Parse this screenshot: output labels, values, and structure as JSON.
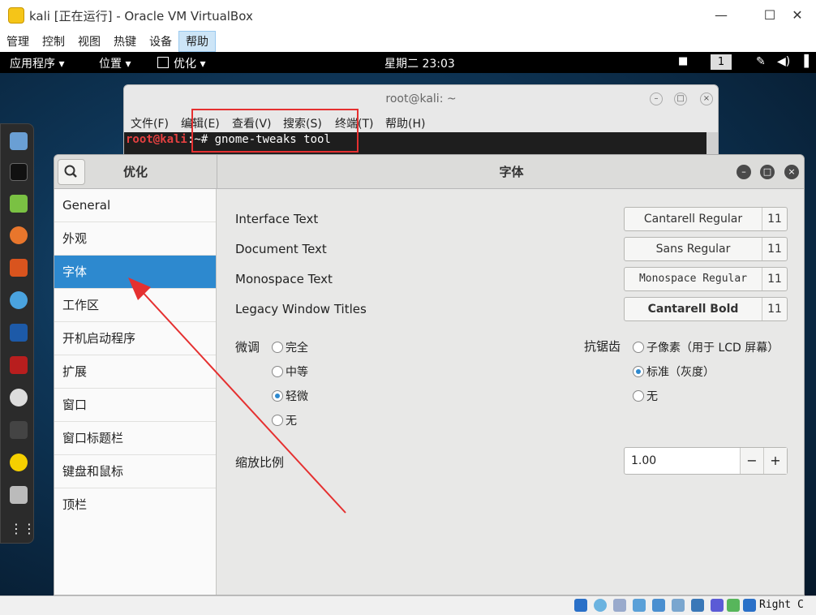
{
  "window": {
    "title": "kali [正在运行] - Oracle VM VirtualBox",
    "minimize": "—",
    "maximize": "☐",
    "close": "✕"
  },
  "vbox_menu": [
    "管理",
    "控制",
    "视图",
    "热键",
    "设备",
    "帮助"
  ],
  "topbar": {
    "apps": "应用程序 ▾",
    "places": "位置 ▾",
    "tweaks": "优化 ▾",
    "clock": "星期二 23:03",
    "workspace": "1"
  },
  "terminal": {
    "title": "root@kali: ~",
    "menu": [
      "文件(F)",
      "编辑(E)",
      "查看(V)",
      "搜索(S)",
      "终端(T)",
      "帮助(H)"
    ],
    "prompt_user": "root@kali",
    "prompt_rest": ":~# gnome-tweaks tool"
  },
  "tweaks": {
    "left_title": "优化",
    "right_title": "字体",
    "sidebar": [
      "General",
      "外观",
      "字体",
      "工作区",
      "开机启动程序",
      "扩展",
      "窗口",
      "窗口标题栏",
      "键盘和鼠标",
      "顶栏"
    ],
    "selected": "字体",
    "fonts": [
      {
        "label": "Interface Text",
        "font": "Cantarell Regular",
        "size": "11"
      },
      {
        "label": "Document Text",
        "font": "Sans Regular",
        "size": "11"
      },
      {
        "label": "Monospace Text",
        "font": "Monospace Regular",
        "size": "11"
      },
      {
        "label": "Legacy Window Titles",
        "font": "Cantarell Bold",
        "size": "11"
      }
    ],
    "hinting_label": "微调",
    "hinting_options": [
      "完全",
      "中等",
      "轻微",
      "无"
    ],
    "hinting_selected": "轻微",
    "antialias_label": "抗锯齿",
    "antialias_options": [
      "子像素（用于 LCD 屏幕）",
      "标准（灰度）",
      "无"
    ],
    "antialias_selected": "标准（灰度）",
    "scale_label": "缩放比例",
    "scale_value": "1.00",
    "scale_minus": "−",
    "scale_plus": "+"
  },
  "statusbar": {
    "hostkey": "Right C"
  },
  "colors": {
    "selection": "#2d89cf",
    "annotation": "#e53030"
  }
}
